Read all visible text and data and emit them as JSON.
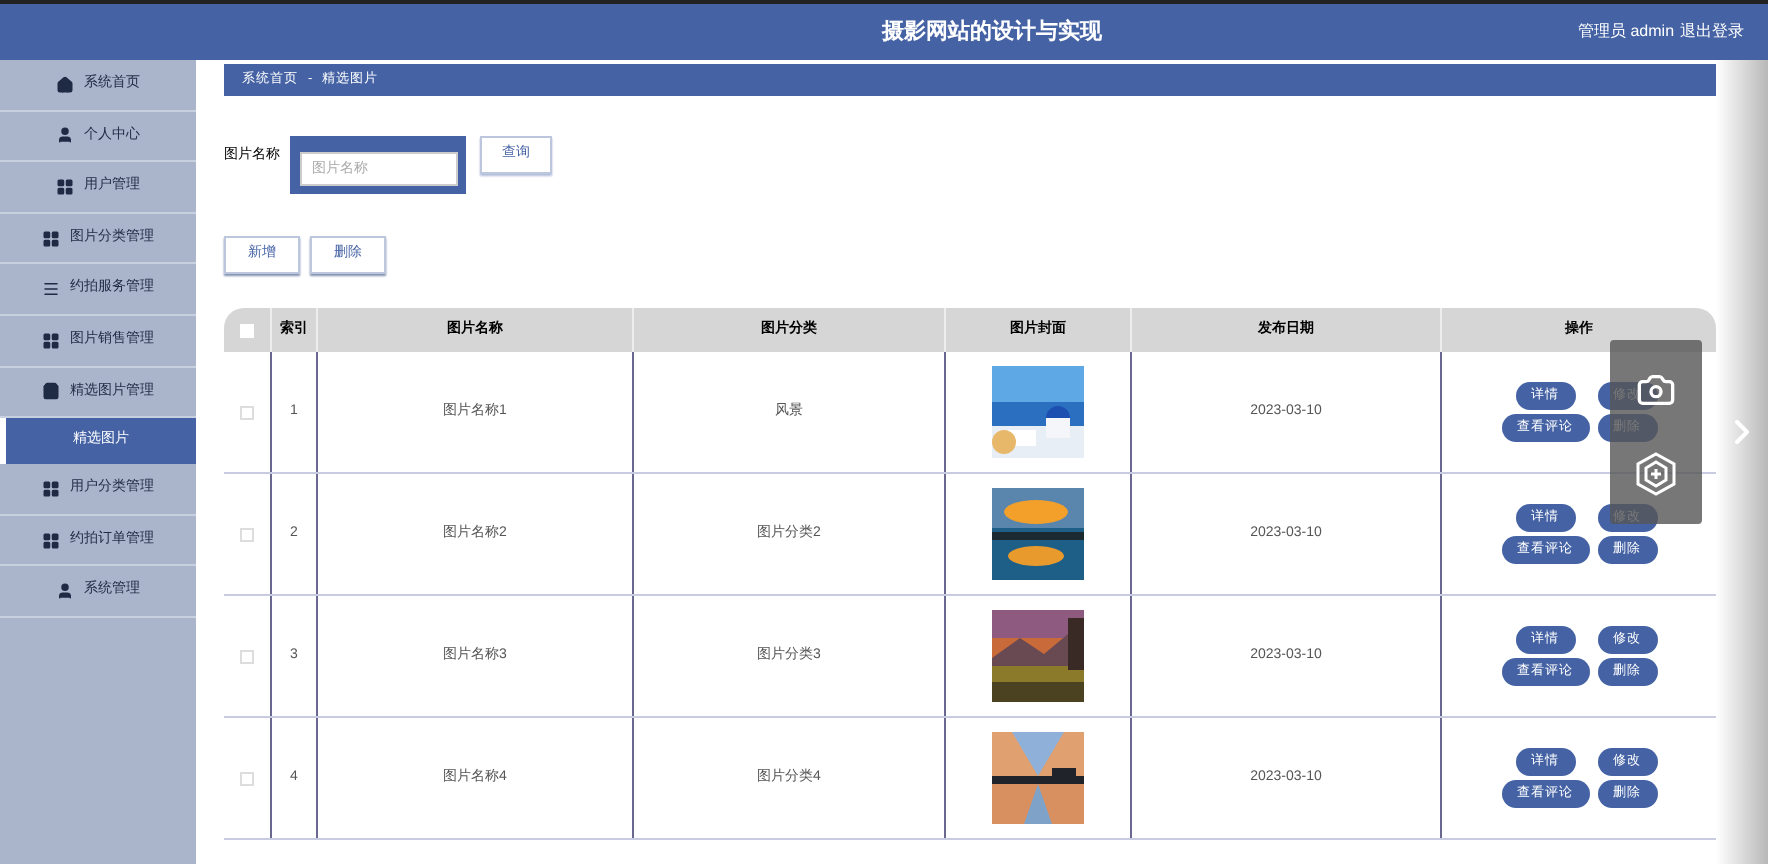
{
  "header": {
    "title": "摄影网站的设计与实现",
    "user": "管理员 admin",
    "logout": "退出登录"
  },
  "sidebar": {
    "items": [
      {
        "label": "系统首页",
        "kind": "home",
        "selected": false
      },
      {
        "label": "个人中心",
        "kind": "user",
        "selected": false
      },
      {
        "label": "用户管理",
        "kind": "grid",
        "selected": false
      },
      {
        "label": "图片分类管理",
        "kind": "grid",
        "selected": false
      },
      {
        "label": "约拍服务管理",
        "kind": "list",
        "selected": false
      },
      {
        "label": "图片销售管理",
        "kind": "grid",
        "selected": false
      },
      {
        "label": "精选图片管理",
        "kind": "bag",
        "selected": false
      },
      {
        "label": "精选图片",
        "kind": "plain",
        "selected": true
      },
      {
        "label": "用户分类管理",
        "kind": "grid",
        "selected": false
      },
      {
        "label": "约拍订单管理",
        "kind": "grid",
        "selected": false
      },
      {
        "label": "系统管理",
        "kind": "user",
        "selected": false
      }
    ]
  },
  "breadcrumb": [
    "系统首页",
    "-",
    "精选图片"
  ],
  "search": {
    "label": "图片名称",
    "placeholder": "图片名称",
    "button": "查询"
  },
  "actions": [
    "新增",
    "删除"
  ],
  "table": {
    "select_all_checked": false,
    "columns": [
      "索引",
      "图片名称",
      "图片分类",
      "图片封面",
      "发布日期",
      "操作"
    ],
    "rows": [
      {
        "checked": false,
        "index": "1",
        "name": "图片名称1",
        "category": "风景",
        "date": "2023-03-10",
        "buttons": [
          "详情",
          "修改",
          "查看评论",
          "删除"
        ]
      },
      {
        "checked": false,
        "index": "2",
        "name": "图片名称2",
        "category": "图片分类2",
        "date": "2023-03-10",
        "buttons": [
          "详情",
          "修改",
          "查看评论",
          "删除"
        ]
      },
      {
        "checked": false,
        "index": "3",
        "name": "图片名称3",
        "category": "图片分类3",
        "date": "2023-03-10",
        "buttons": [
          "详情",
          "修改",
          "查看评论",
          "删除"
        ]
      },
      {
        "checked": false,
        "index": "4",
        "name": "图片名称4",
        "category": "图片分类4",
        "date": "2023-03-10",
        "buttons": [
          "详情",
          "修改",
          "查看评论",
          "删除"
        ]
      }
    ]
  }
}
